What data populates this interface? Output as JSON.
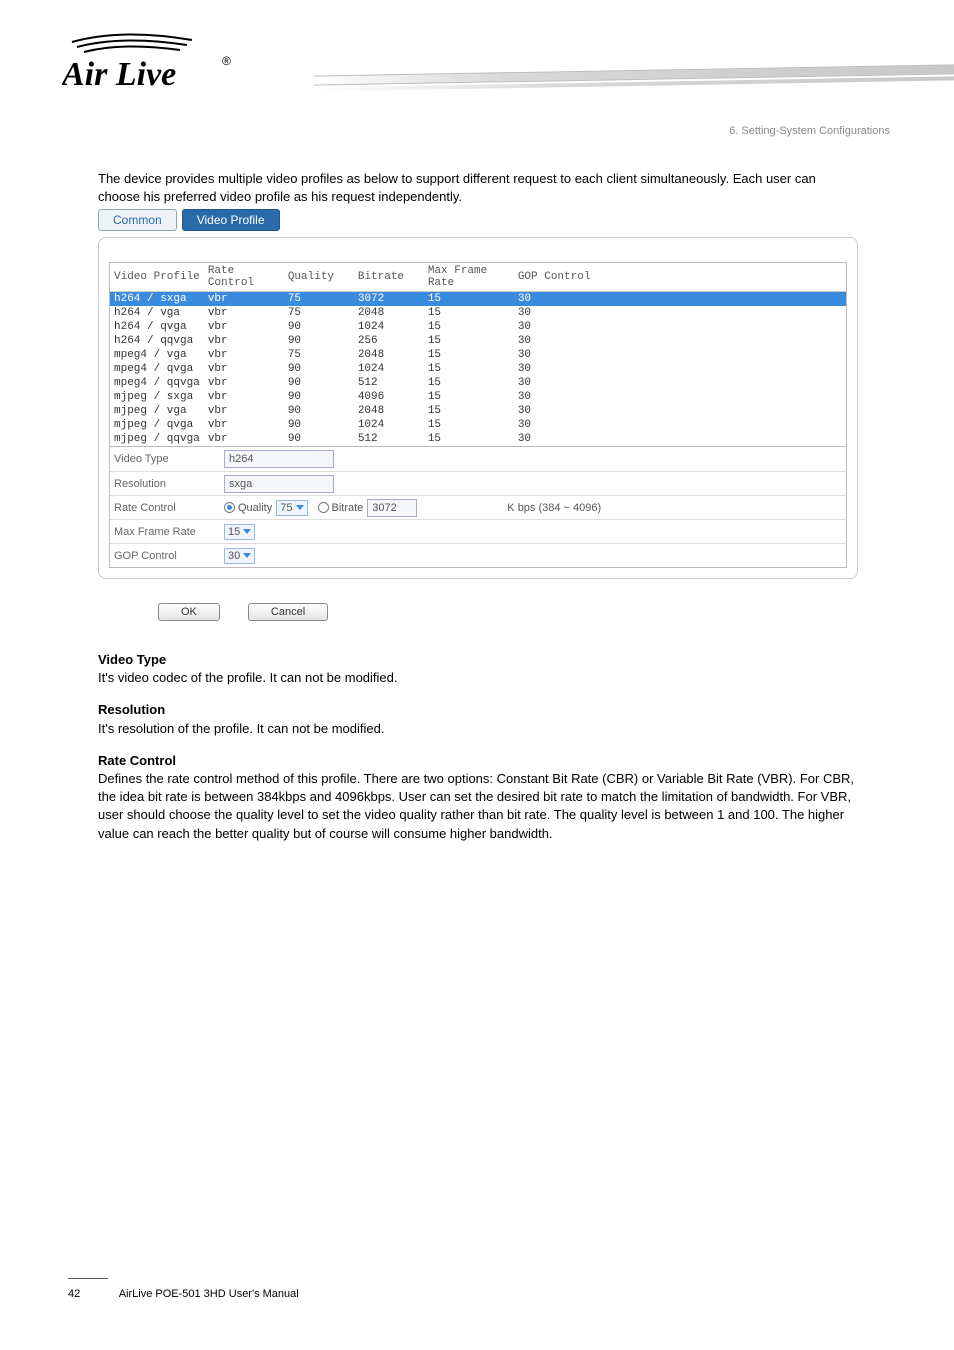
{
  "chapter": "6. Setting-System Configurations",
  "logo_text": "Air Live",
  "logo_mark": "®",
  "intro": "The device provides multiple video profiles as below to support different request to each client simultaneously. Each user can choose his preferred video profile as his request independently.",
  "tabs": {
    "common": "Common",
    "video_profile": "Video Profile"
  },
  "table": {
    "headers": [
      "Video Profile",
      "Rate Control",
      "Quality",
      "Bitrate",
      "Max Frame Rate",
      "GOP Control"
    ],
    "rows": [
      {
        "profile": "h264 / sxga",
        "rc": "vbr",
        "q": "75",
        "br": "3072",
        "mfr": "15",
        "gop": "30",
        "selected": true
      },
      {
        "profile": "h264 / vga",
        "rc": "vbr",
        "q": "75",
        "br": "2048",
        "mfr": "15",
        "gop": "30"
      },
      {
        "profile": "h264 / qvga",
        "rc": "vbr",
        "q": "90",
        "br": "1024",
        "mfr": "15",
        "gop": "30"
      },
      {
        "profile": "h264 / qqvga",
        "rc": "vbr",
        "q": "90",
        "br": "256",
        "mfr": "15",
        "gop": "30"
      },
      {
        "profile": "mpeg4 / vga",
        "rc": "vbr",
        "q": "75",
        "br": "2048",
        "mfr": "15",
        "gop": "30"
      },
      {
        "profile": "mpeg4 / qvga",
        "rc": "vbr",
        "q": "90",
        "br": "1024",
        "mfr": "15",
        "gop": "30"
      },
      {
        "profile": "mpeg4 / qqvga",
        "rc": "vbr",
        "q": "90",
        "br": "512",
        "mfr": "15",
        "gop": "30"
      },
      {
        "profile": "mjpeg / sxga",
        "rc": "vbr",
        "q": "90",
        "br": "4096",
        "mfr": "15",
        "gop": "30"
      },
      {
        "profile": "mjpeg / vga",
        "rc": "vbr",
        "q": "90",
        "br": "2048",
        "mfr": "15",
        "gop": "30"
      },
      {
        "profile": "mjpeg / qvga",
        "rc": "vbr",
        "q": "90",
        "br": "1024",
        "mfr": "15",
        "gop": "30"
      },
      {
        "profile": "mjpeg / qqvga",
        "rc": "vbr",
        "q": "90",
        "br": "512",
        "mfr": "15",
        "gop": "30"
      }
    ]
  },
  "form": {
    "video_type": {
      "label": "Video Type",
      "value": "h264"
    },
    "resolution": {
      "label": "Resolution",
      "value": "sxga"
    },
    "rate_control": {
      "label": "Rate Control",
      "quality_label": "Quality",
      "quality_value": "75",
      "bitrate_label": "Bitrate",
      "bitrate_value": "3072",
      "range": "K bps (384 ~ 4096)"
    },
    "max_frame_rate": {
      "label": "Max Frame Rate",
      "value": "15"
    },
    "gop_control": {
      "label": "GOP Control",
      "value": "30"
    }
  },
  "buttons": {
    "ok": "OK",
    "cancel": "Cancel"
  },
  "sections": {
    "video_type": {
      "title": "Video Type",
      "body": "It's video codec of the profile. It can not be modified."
    },
    "resolution": {
      "title": "Resolution",
      "body": "It's resolution of the profile. It can not be modified."
    },
    "rate_control": {
      "title": "Rate Control",
      "body": "Defines the rate control method of this profile. There are two options: Constant Bit Rate (CBR) or Variable Bit Rate (VBR). For CBR, the idea bit rate is between 384kbps and 4096kbps. User can set the desired bit rate to match the limitation of bandwidth. For VBR, user should choose the quality level to set the video quality rather than bit rate. The quality level is between 1 and 100. The higher value can reach the better quality but of course will consume higher bandwidth."
    }
  },
  "footer": {
    "page": "42",
    "product": "AirLive POE-501 3HD User's Manual"
  }
}
